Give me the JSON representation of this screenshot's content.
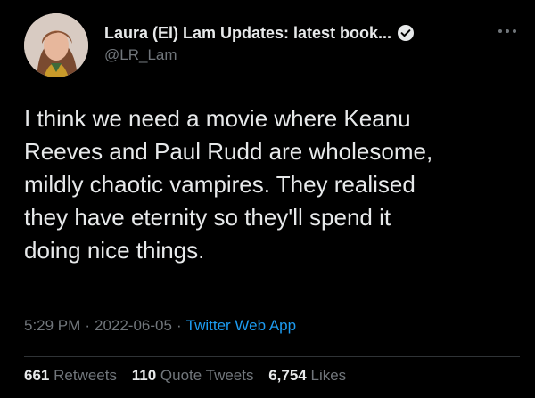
{
  "tweet": {
    "author": {
      "display_name": "Laura (El) Lam Updates: latest book...",
      "handle": "@LR_Lam",
      "verified": true,
      "avatar_icon": "profile-photo"
    },
    "text": "I think we need a movie where Keanu\nReeves and Paul Rudd are wholesome,\nmildly chaotic vampires. They realised\nthey have eternity so they'll spend it\ndoing nice things.",
    "time": "5:29 PM",
    "date": "2022-06-05",
    "source": "Twitter Web App",
    "stats": {
      "retweets_count": "661",
      "retweets_label": "Retweets",
      "quote_tweets_count": "110",
      "quote_tweets_label": "Quote Tweets",
      "likes_count": "6,754",
      "likes_label": "Likes"
    }
  },
  "colors": {
    "background": "#000000",
    "primary_text": "#e7e9ea",
    "secondary_text": "#71767b",
    "link": "#1d9bf0",
    "divider": "#2f3336"
  }
}
